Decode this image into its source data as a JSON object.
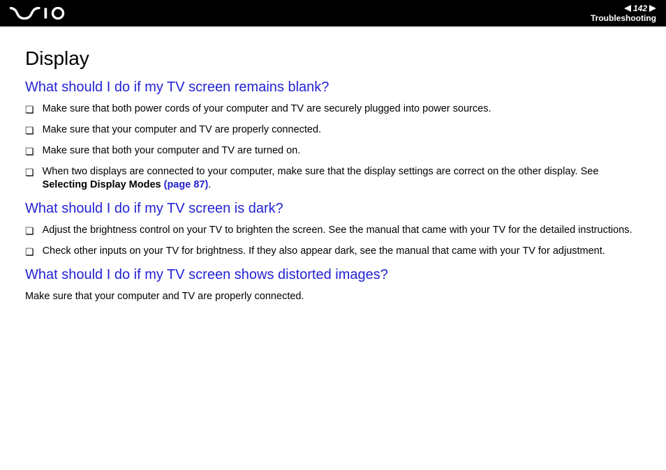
{
  "header": {
    "page_number": "142",
    "section_label": "Troubleshooting"
  },
  "section_title": "Display",
  "questions": [
    {
      "title": "What should I do if my TV screen remains blank?",
      "bullets": [
        "Make sure that both power cords of your computer and TV are securely plugged into power sources.",
        "Make sure that your computer and TV are properly connected.",
        "Make sure that both your computer and TV are turned on."
      ],
      "bullet_with_link": {
        "prefix": "When two displays are connected to your computer, make sure that the display settings are correct on the other display. See ",
        "bold_text": "Selecting Display Modes ",
        "link_text": "(page 87)",
        "suffix": "."
      }
    },
    {
      "title": "What should I do if my TV screen is dark?",
      "bullets": [
        "Adjust the brightness control on your TV to brighten the screen. See the manual that came with your TV for the detailed instructions.",
        "Check other inputs on your TV for brightness. If they also appear dark, see the manual that came with your TV for adjustment."
      ]
    },
    {
      "title": "What should I do if my TV screen shows distorted images?",
      "paragraph": "Make sure that your computer and TV are properly connected."
    }
  ]
}
